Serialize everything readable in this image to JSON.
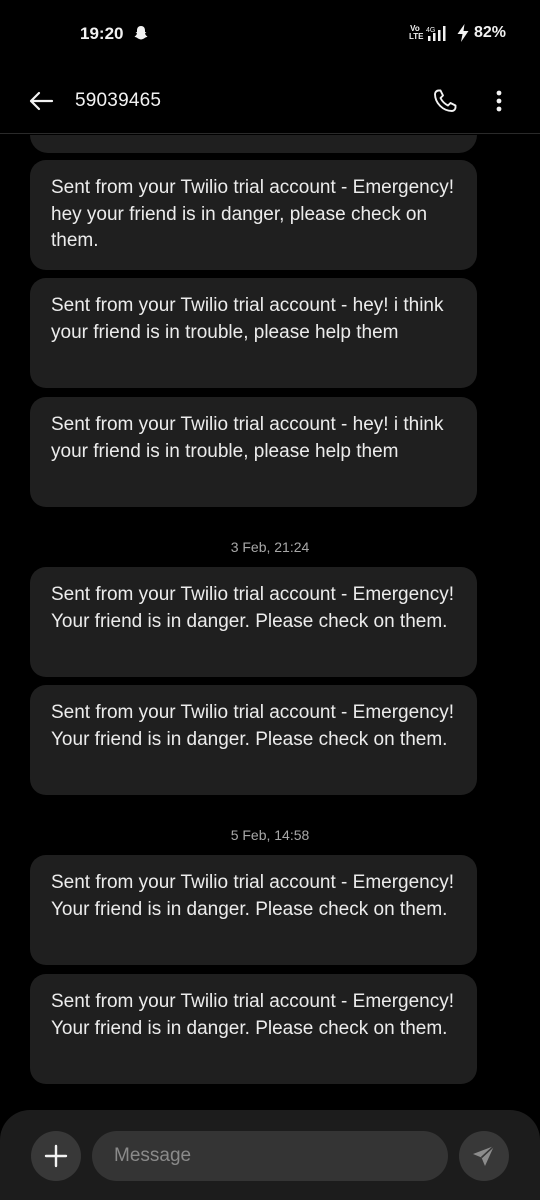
{
  "status_bar": {
    "time": "19:20",
    "network": "Vo LTE",
    "signal_label": "4G",
    "battery": "82%",
    "notification_icon": "snapchat-ghost-icon"
  },
  "header": {
    "title": "59039465",
    "back_icon": "arrow-left-icon",
    "call_icon": "phone-icon",
    "more_icon": "more-vertical-icon"
  },
  "messages": [
    {
      "text": "Sent from your Twilio trial account - Emergency! hey your friend is in danger, please check on them."
    },
    {
      "text": "Sent from your Twilio trial account - hey! i think your friend is in trouble, please help them"
    },
    {
      "text": "Sent from your Twilio trial account - hey! i think your friend is in trouble, please help them"
    },
    {
      "date": "3 Feb, 21:24"
    },
    {
      "text": "Sent from your Twilio trial account - Emergency! Your friend is in danger. Please check on them."
    },
    {
      "text": "Sent from your Twilio trial account - Emergency! Your friend is in danger. Please check on them."
    },
    {
      "date": "5 Feb, 14:58"
    },
    {
      "text": "Sent from your Twilio trial account - Emergency! Your friend is in danger. Please check on them."
    },
    {
      "text": "Sent from your Twilio trial account - Emergency! Your friend is in danger. Please check on them."
    }
  ],
  "composer": {
    "placeholder": "Message",
    "value": "",
    "add_icon": "plus-icon",
    "send_icon": "send-icon"
  },
  "colors": {
    "background": "#000000",
    "bubble": "#1f1f1f",
    "composer": "#1c1c1c",
    "text": "#ececec",
    "muted": "#a8a8a8"
  }
}
